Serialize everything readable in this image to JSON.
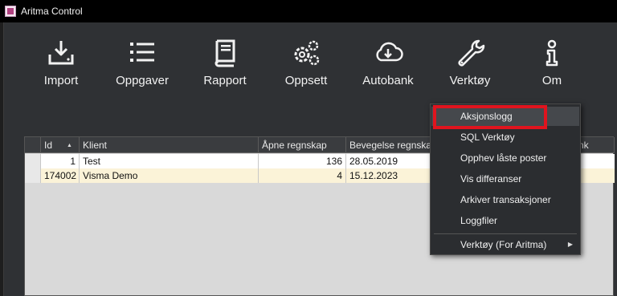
{
  "window": {
    "title": "Aritma Control"
  },
  "toolbar": {
    "items": [
      {
        "label": "Import",
        "icon": "download-tray-icon"
      },
      {
        "label": "Oppgaver",
        "icon": "list-icon"
      },
      {
        "label": "Rapport",
        "icon": "book-icon"
      },
      {
        "label": "Oppsett",
        "icon": "gears-icon"
      },
      {
        "label": "Autobank",
        "icon": "cloud-download-icon"
      },
      {
        "label": "Verktøy",
        "icon": "wrench-icon"
      },
      {
        "label": "Om",
        "icon": "info-icon"
      }
    ]
  },
  "grid": {
    "columns": [
      "Id",
      "Klient",
      "Åpne regnskap",
      "Bevegelse regnskap",
      "nk"
    ],
    "rows": [
      {
        "id": "1",
        "klient": "Test",
        "apne": "136",
        "bevegelse": "28.05.2019"
      },
      {
        "id": "174002",
        "klient": "Visma Demo",
        "apne": "4",
        "bevegelse": "15.12.2023"
      }
    ]
  },
  "menu": {
    "items": [
      "Aksjonslogg",
      "SQL Verktøy",
      "Opphev låste poster",
      "Vis differanser",
      "Arkiver transaksjoner",
      "Loggfiler",
      "Verktøy (For Aritma)"
    ]
  },
  "colors": {
    "highlight": "#e0141e",
    "header_bg": "#3a3c3f",
    "row_alt": "#fbf3d8"
  }
}
